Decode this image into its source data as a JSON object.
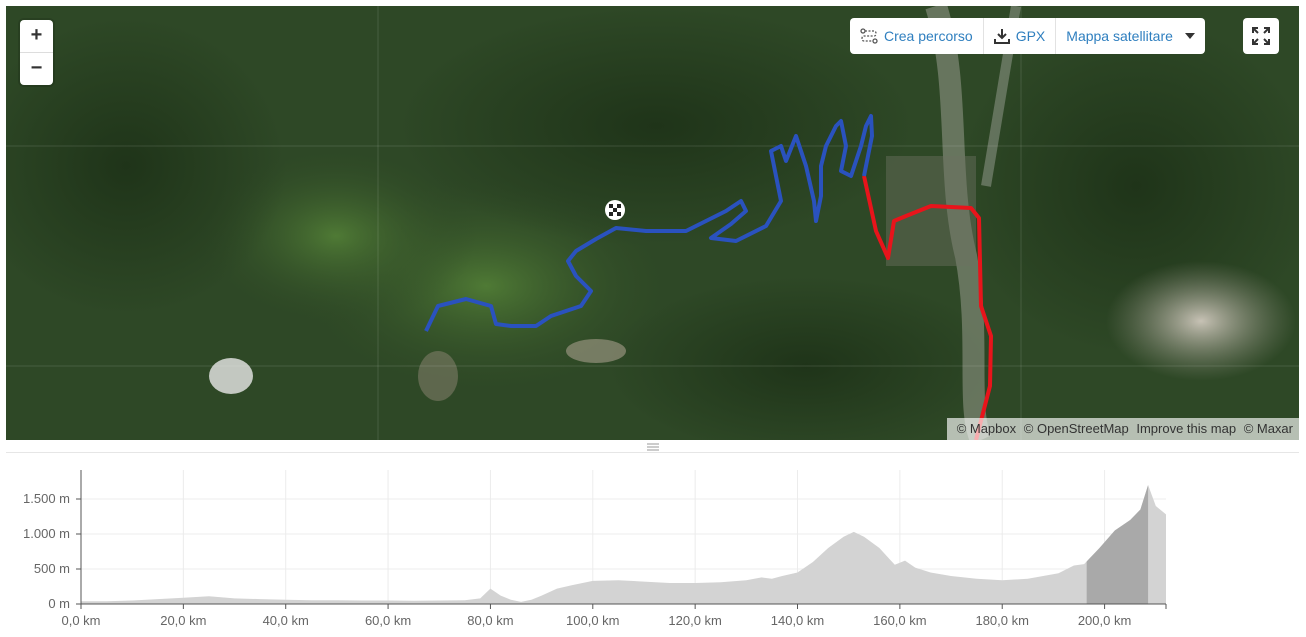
{
  "map": {
    "zoom_in_label": "+",
    "zoom_out_label": "−",
    "toolbar": {
      "create_route_label": "Crea percorso",
      "gpx_label": "GPX",
      "map_type_label": "Mappa satellitare"
    },
    "attribution": [
      "© Mapbox",
      "© OpenStreetMap",
      "Improve this map",
      "© Maxar"
    ],
    "route_colors": {
      "blue": "#2a52be",
      "red": "#e8141b"
    }
  },
  "chart_data": {
    "type": "area",
    "xlabel": "",
    "ylabel": "",
    "xlim": [
      0,
      212
    ],
    "ylim": [
      0,
      1800
    ],
    "x_ticks": [
      "0,0 km",
      "20,0 km",
      "40,0 km",
      "60,0 km",
      "80,0 km",
      "100,0 km",
      "120,0 km",
      "140,0 km",
      "160,0 km",
      "180,0 km",
      "200,0 km"
    ],
    "y_ticks": [
      "0 m",
      "500 m",
      "1.000 m",
      "1.500 m"
    ],
    "x_tick_values": [
      0,
      20,
      40,
      60,
      80,
      100,
      120,
      140,
      160,
      180,
      200
    ],
    "y_tick_values": [
      0,
      500,
      1000,
      1500
    ],
    "highlight_range": [
      196.5,
      208.5
    ],
    "series": [
      {
        "x": [
          0,
          5,
          10,
          15,
          20,
          25,
          30,
          35,
          40,
          45,
          50,
          55,
          60,
          65,
          70,
          75,
          78,
          80,
          82,
          84,
          86,
          88,
          90,
          93,
          96,
          100,
          105,
          110,
          115,
          120,
          125,
          130,
          133,
          135,
          137,
          140,
          143,
          146,
          149,
          151,
          153,
          156,
          159,
          161,
          163,
          166,
          170,
          175,
          180,
          185,
          188,
          191,
          194,
          196,
          199,
          202,
          205,
          207,
          208.5,
          210,
          212
        ],
        "y": [
          40,
          40,
          50,
          70,
          90,
          110,
          80,
          70,
          60,
          55,
          55,
          50,
          50,
          45,
          50,
          55,
          80,
          220,
          120,
          60,
          30,
          60,
          120,
          220,
          270,
          330,
          340,
          320,
          300,
          300,
          310,
          340,
          380,
          360,
          400,
          450,
          600,
          800,
          960,
          1030,
          960,
          800,
          560,
          620,
          520,
          450,
          400,
          360,
          340,
          360,
          400,
          440,
          550,
          570,
          800,
          1050,
          1200,
          1350,
          1700,
          1400,
          1280
        ]
      }
    ]
  }
}
